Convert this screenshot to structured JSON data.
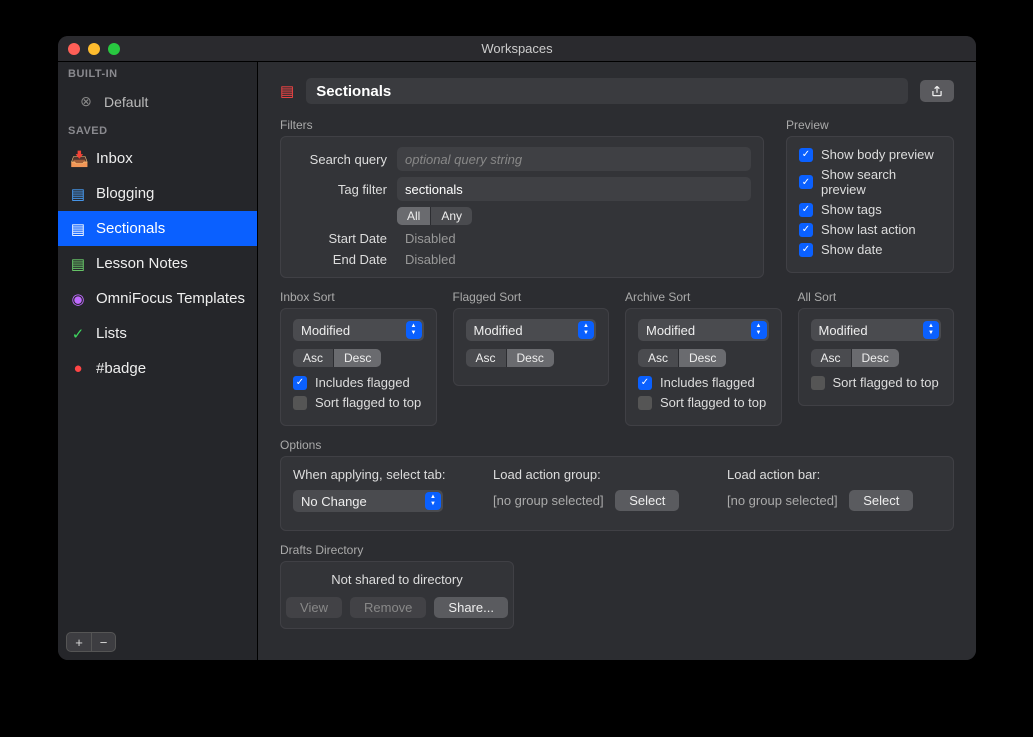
{
  "window": {
    "title": "Workspaces"
  },
  "sidebar": {
    "builtin_header": "BUILT-IN",
    "default_label": "Default",
    "saved_header": "SAVED",
    "items": [
      {
        "label": "Inbox",
        "icon": "📥",
        "icon_name": "inbox-icon",
        "color": "#4aa3ff",
        "selected": false
      },
      {
        "label": "Blogging",
        "icon": "▤",
        "icon_name": "page-icon",
        "color": "#4aa3ff",
        "selected": false
      },
      {
        "label": "Sectionals",
        "icon": "▤",
        "icon_name": "page-icon",
        "color": "#ff4545",
        "selected": true
      },
      {
        "label": "Lesson Notes",
        "icon": "▤",
        "icon_name": "page-icon",
        "color": "#6fd66f",
        "selected": false
      },
      {
        "label": "OmniFocus Templates",
        "icon": "◉",
        "icon_name": "target-icon",
        "color": "#c06aff",
        "selected": false
      },
      {
        "label": "Lists",
        "icon": "✓",
        "icon_name": "check-icon",
        "color": "#3fd65f",
        "selected": false
      },
      {
        "label": "#badge",
        "icon": "●",
        "icon_name": "dot-icon",
        "color": "#ff4545",
        "selected": false
      }
    ]
  },
  "workspace": {
    "name": "Sectionals"
  },
  "filters": {
    "title": "Filters",
    "search_label": "Search query",
    "search_placeholder": "optional query string",
    "tag_label": "Tag filter",
    "tag_value": "sectionals",
    "scope": {
      "all": "All",
      "any": "Any",
      "active": "all"
    },
    "start_label": "Start Date",
    "start_value": "Disabled",
    "end_label": "End Date",
    "end_value": "Disabled"
  },
  "preview": {
    "title": "Preview",
    "items": [
      {
        "label": "Show body preview",
        "checked": true
      },
      {
        "label": "Show search preview",
        "checked": true
      },
      {
        "label": "Show tags",
        "checked": true
      },
      {
        "label": "Show last action",
        "checked": true
      },
      {
        "label": "Show date",
        "checked": true
      }
    ]
  },
  "sorts": {
    "asc_label": "Asc",
    "desc_label": "Desc",
    "inbox": {
      "title": "Inbox Sort",
      "value": "Modified",
      "dir": "desc",
      "includes_flagged": {
        "label": "Includes flagged",
        "checked": true
      },
      "sort_flagged_top": {
        "label": "Sort flagged to top",
        "checked": false
      }
    },
    "flagged": {
      "title": "Flagged Sort",
      "value": "Modified",
      "dir": "desc"
    },
    "archive": {
      "title": "Archive Sort",
      "value": "Modified",
      "dir": "desc",
      "includes_flagged": {
        "label": "Includes flagged",
        "checked": true
      },
      "sort_flagged_top": {
        "label": "Sort flagged to top",
        "checked": false
      }
    },
    "all": {
      "title": "All Sort",
      "value": "Modified",
      "dir": "desc",
      "sort_flagged_top": {
        "label": "Sort flagged to top",
        "checked": false
      }
    }
  },
  "options": {
    "title": "Options",
    "select_tab_label": "When applying, select tab:",
    "select_tab_value": "No Change",
    "action_group_label": "Load action group:",
    "action_group_value": "[no group selected]",
    "action_bar_label": "Load action bar:",
    "action_bar_value": "[no group selected]",
    "select_btn": "Select"
  },
  "drafts_dir": {
    "title": "Drafts Directory",
    "status": "Not shared to directory",
    "view": "View",
    "remove": "Remove",
    "share": "Share..."
  }
}
